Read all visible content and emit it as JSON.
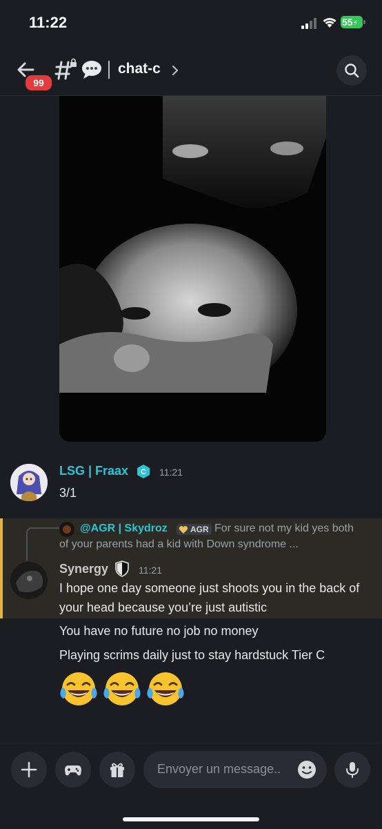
{
  "status": {
    "time": "11:22",
    "battery": "55"
  },
  "header": {
    "back_badge": "99",
    "channel": "chat-c"
  },
  "messages": [
    {
      "author": "LSG | Fraax",
      "time": "11:21",
      "text": "3/1",
      "name_color": "#29c4d6"
    },
    {
      "author": "Synergy",
      "time": "11:21",
      "name_color": "#c9c9c9",
      "reply": {
        "author": "@AGR | Skydroz",
        "tag": "AGR",
        "text": "For sure not my kid yes both",
        "text2": "of your parents had a kid with Down syndrome ..."
      },
      "text": "I hope one day someone just shoots you in the back of your head because you’re just autistic"
    }
  ],
  "followups": [
    "You have no future no job no money",
    "Playing scrims daily just to stay hardstuck Tier C"
  ],
  "emojis": [
    "laughing-tears",
    "laughing-tears",
    "laughing-tears"
  ],
  "composer": {
    "placeholder": "Envoyer un message.."
  },
  "colors": {
    "accent": "#29c4d6",
    "highlight": "#e8b23a",
    "badge": "#e23c3f"
  }
}
